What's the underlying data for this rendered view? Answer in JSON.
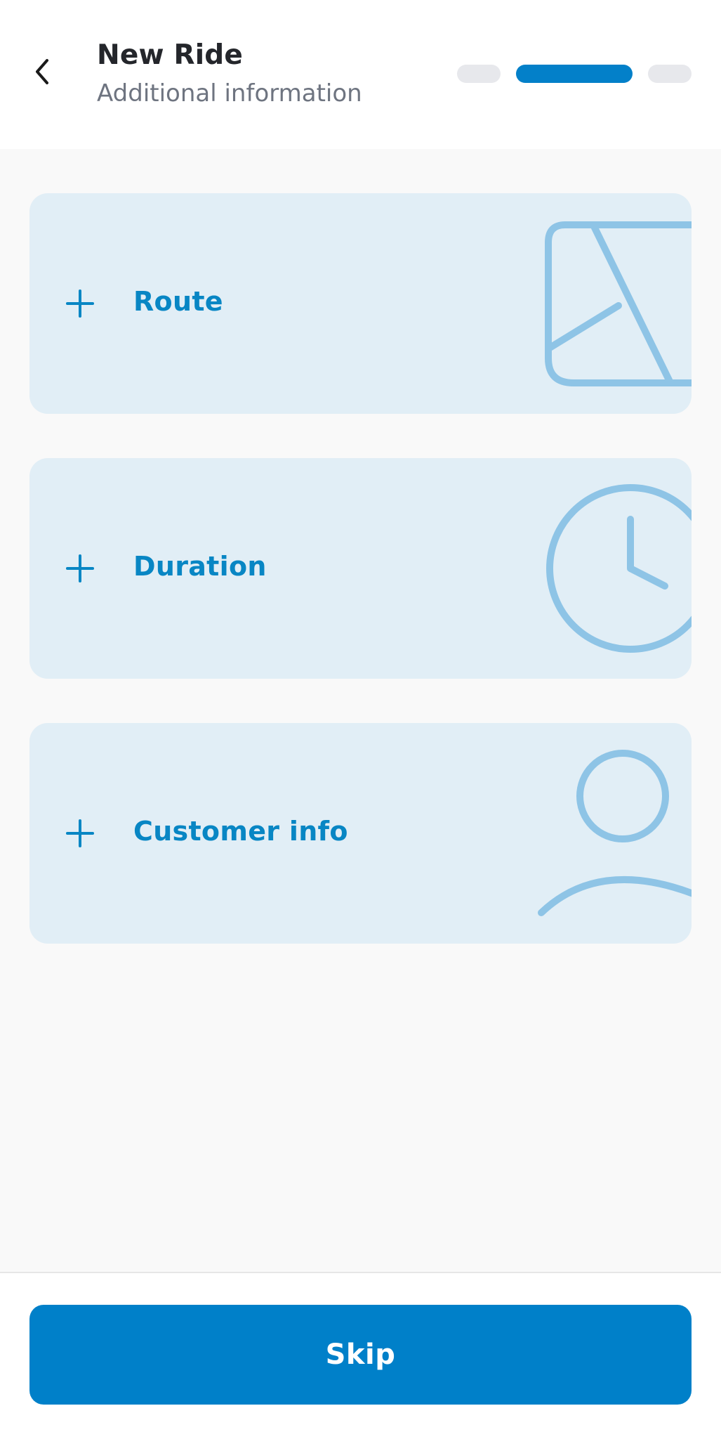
{
  "header": {
    "title": "New Ride",
    "subtitle": "Additional information",
    "back_icon": "chevron-left-icon"
  },
  "stepper": {
    "total_steps": 3,
    "current_step": 2,
    "active_color": "#0380c9",
    "inactive_color": "#e7e8ec"
  },
  "options": [
    {
      "label": "Route",
      "icon": "map-icon"
    },
    {
      "label": "Duration",
      "icon": "clock-icon"
    },
    {
      "label": "Customer info",
      "icon": "user-icon"
    }
  ],
  "footer": {
    "skip_label": "Skip"
  },
  "colors": {
    "primary": "#0080c9",
    "card_background": "#e1eef6",
    "card_text": "#0886c4",
    "illustration": "#8ec4e6"
  }
}
